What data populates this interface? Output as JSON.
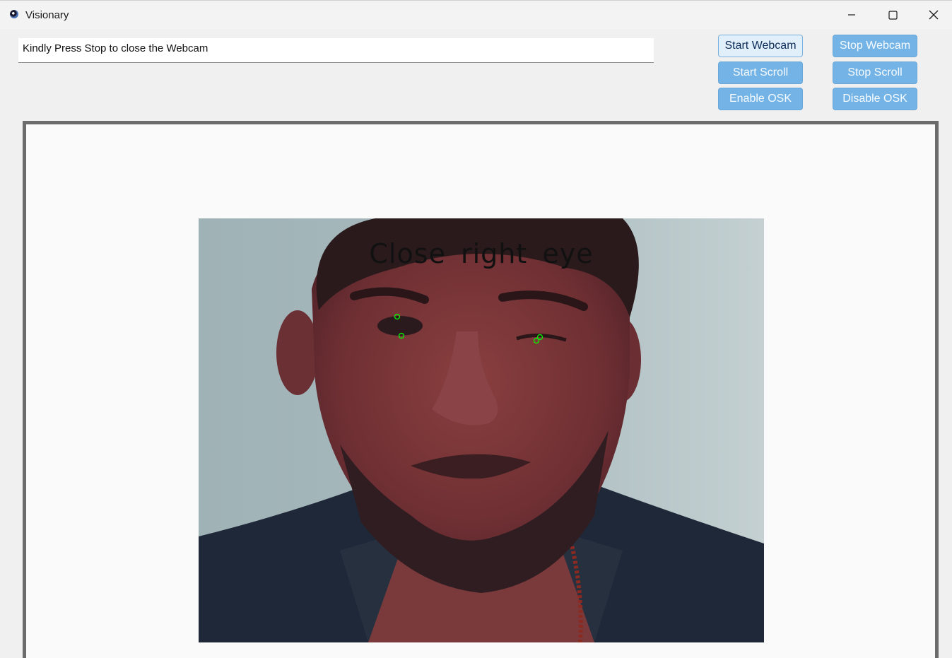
{
  "window": {
    "title": "Visionary",
    "app_icon": "eye-icon",
    "controls": {
      "minimize_icon": "minimize-icon",
      "maximize_icon": "maximize-icon",
      "close_icon": "close-icon"
    }
  },
  "status": {
    "message": "Kindly Press Stop to close the Webcam"
  },
  "buttons": {
    "start_webcam": "Start Webcam",
    "stop_webcam": "Stop Webcam",
    "start_scroll": "Start Scroll",
    "stop_scroll": "Stop Scroll",
    "enable_osk": "Enable OSK",
    "disable_osk": "Disable OSK"
  },
  "webcam": {
    "overlay_instruction": "Close right eye",
    "landmark_color": "#00ff00"
  },
  "colors": {
    "button_active_bg": "#e1effa",
    "button_muted_bg": "#74b3e5",
    "frame_border": "#6b6b6b"
  }
}
